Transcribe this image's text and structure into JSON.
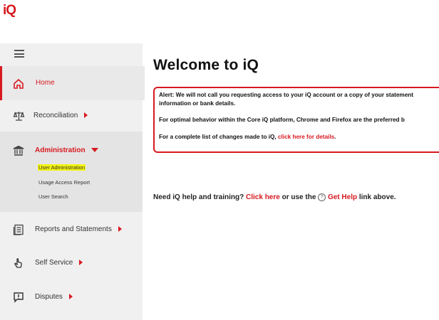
{
  "app": {
    "logo": "iQ"
  },
  "sidebar": {
    "home": "Home",
    "reconciliation": "Reconciliation",
    "administration": "Administration",
    "admin_items": [
      "User Administration",
      "Usage Access Report",
      "User Search"
    ],
    "reports": "Reports and Statements",
    "self_service": "Self Service",
    "disputes": "Disputes"
  },
  "main": {
    "title": "Welcome to iQ",
    "alert_line1": "Alert: We will not call you requesting access to your iQ account or a copy of your statement",
    "alert_line2": "information or bank details.",
    "alert_line3": "For optimal behavior within the Core iQ platform, Chrome and Firefox are the preferred b",
    "alert_line4_prefix": "For a complete list of changes made to iQ, ",
    "alert_line4_link": "click here for details",
    "alert_line4_suffix": ".",
    "help_prefix": "Need iQ help and training? ",
    "help_link1": "Click here",
    "help_middle": " or use the ",
    "help_q": "?",
    "help_link2": "Get Help",
    "help_suffix": " link above."
  },
  "colors": {
    "accent": "#d71920",
    "highlight": "#f4f410",
    "sidebar_bg": "#f0f0f0"
  }
}
